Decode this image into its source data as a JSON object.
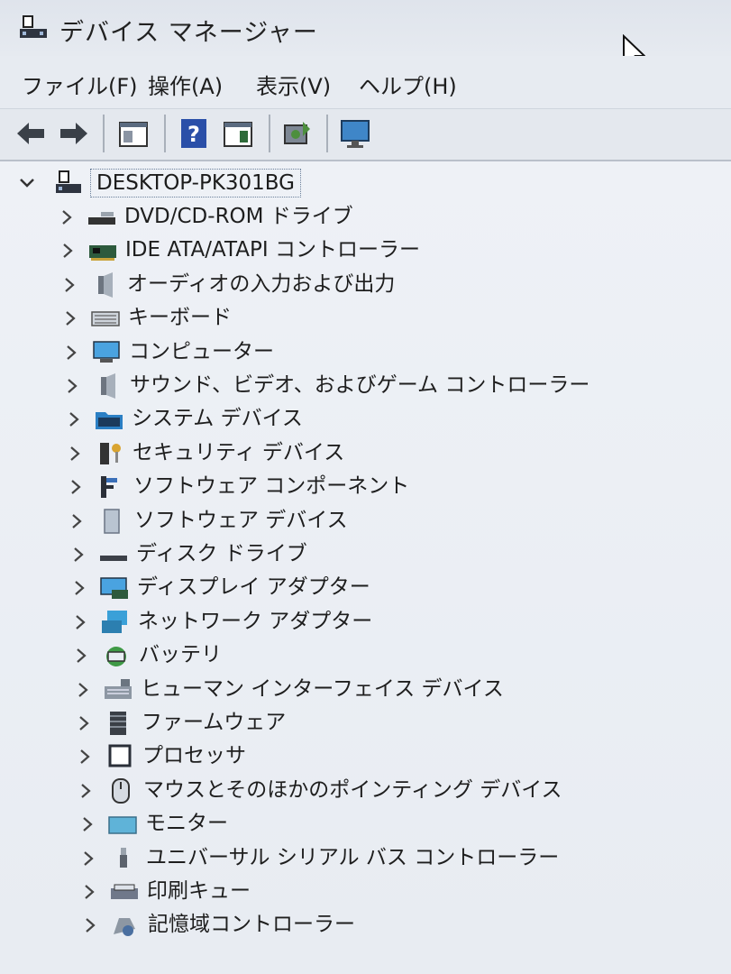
{
  "window": {
    "title": "デバイス マネージャー"
  },
  "menu": [
    {
      "label": "ファイル(F)"
    },
    {
      "label": "操作(A)"
    },
    {
      "label": "表示(V)"
    },
    {
      "label": "ヘルプ(H)"
    }
  ],
  "toolbar": {
    "buttons": [
      {
        "icon": "back-arrow-icon"
      },
      {
        "icon": "forward-arrow-icon"
      },
      {
        "icon": "properties-pane-icon"
      },
      {
        "icon": "help-icon"
      },
      {
        "icon": "console-view-icon"
      },
      {
        "icon": "scan-hardware-icon"
      },
      {
        "icon": "monitor-icon"
      }
    ]
  },
  "tree": {
    "root": {
      "label": "DESKTOP-PK301BG"
    },
    "items": [
      {
        "label": "DVD/CD-ROM ドライブ",
        "icon": "dvd-drive-icon"
      },
      {
        "label": "IDE ATA/ATAPI コントローラー",
        "icon": "ide-controller-icon"
      },
      {
        "label": "オーディオの入力および出力",
        "icon": "speaker-icon"
      },
      {
        "label": "キーボード",
        "icon": "keyboard-icon"
      },
      {
        "label": "コンピューター",
        "icon": "computer-icon"
      },
      {
        "label": "サウンド、ビデオ、およびゲーム コントローラー",
        "icon": "speaker-icon"
      },
      {
        "label": "システム デバイス",
        "icon": "system-folder-icon"
      },
      {
        "label": "セキュリティ デバイス",
        "icon": "security-key-icon"
      },
      {
        "label": "ソフトウェア コンポーネント",
        "icon": "software-component-icon"
      },
      {
        "label": "ソフトウェア デバイス",
        "icon": "software-device-icon"
      },
      {
        "label": "ディスク ドライブ",
        "icon": "disk-drive-icon"
      },
      {
        "label": "ディスプレイ アダプター",
        "icon": "display-adapter-icon"
      },
      {
        "label": "ネットワーク アダプター",
        "icon": "network-adapter-icon"
      },
      {
        "label": "バッテリ",
        "icon": "battery-icon"
      },
      {
        "label": "ヒューマン インターフェイス デバイス",
        "icon": "hid-icon"
      },
      {
        "label": "ファームウェア",
        "icon": "firmware-icon"
      },
      {
        "label": "プロセッサ",
        "icon": "processor-icon"
      },
      {
        "label": "マウスとそのほかのポインティング デバイス",
        "icon": "mouse-icon"
      },
      {
        "label": "モニター",
        "icon": "monitor-icon"
      },
      {
        "label": "ユニバーサル シリアル バス コントローラー",
        "icon": "usb-icon"
      },
      {
        "label": "印刷キュー",
        "icon": "printer-icon"
      },
      {
        "label": "記憶域コントローラー",
        "icon": "storage-controller-icon"
      }
    ]
  }
}
